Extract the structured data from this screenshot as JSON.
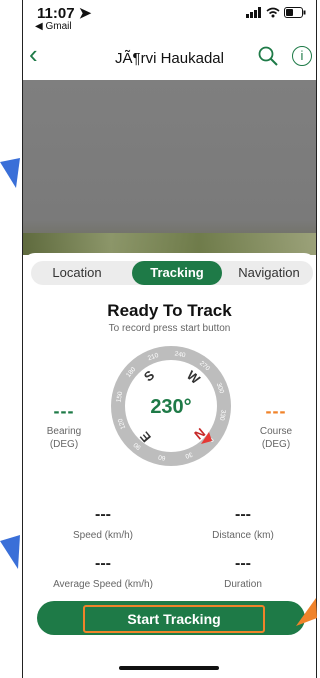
{
  "status": {
    "time": "11:07",
    "back_app": "◀ Gmail"
  },
  "nav": {
    "title": "JÃ¶rvi Haukadal"
  },
  "tabs": [
    {
      "label": "Location",
      "active": false
    },
    {
      "label": "Tracking",
      "active": true
    },
    {
      "label": "Navigation",
      "active": false
    }
  ],
  "main": {
    "title": "Ready To Track",
    "subtitle": "To record press start button"
  },
  "bearing": {
    "value": "---",
    "label1": "Bearing",
    "label2": "(DEG)",
    "color": "#1e7a47"
  },
  "course": {
    "value": "---",
    "label1": "Course",
    "label2": "(DEG)",
    "color": "#f0832a"
  },
  "compass": {
    "heading": "230°",
    "ticks": [
      "210",
      "240",
      "270",
      "300",
      "330",
      "0",
      "30",
      "60",
      "90",
      "120",
      "150",
      "180"
    ],
    "cardinals": [
      "S",
      "W",
      "N",
      "E"
    ]
  },
  "stats": {
    "speed": {
      "value": "---",
      "label": "Speed (km/h)"
    },
    "distance": {
      "value": "---",
      "label": "Distance (km)"
    },
    "avg_speed": {
      "value": "---",
      "label": "Average Speed (km/h)"
    },
    "duration": {
      "value": "---",
      "label": "Duration"
    }
  },
  "start_button": {
    "label": "Start Tracking"
  },
  "colors": {
    "accent": "#1e7a47",
    "highlight": "#f0832a"
  }
}
